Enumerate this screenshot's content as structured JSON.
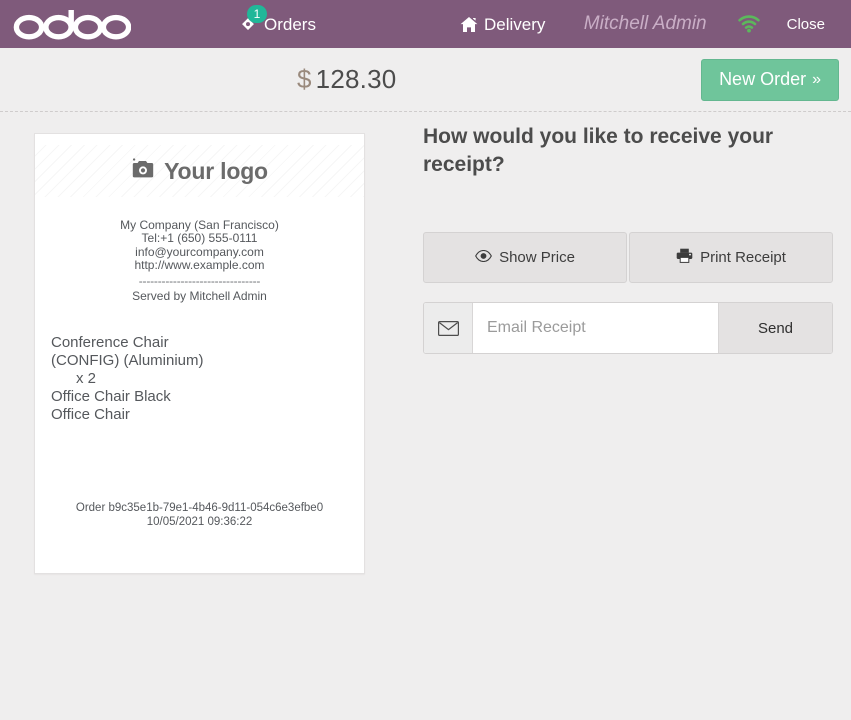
{
  "topbar": {
    "brand": "odoo",
    "orders": {
      "label": "Orders",
      "badge": "1",
      "icon": "tag-icon"
    },
    "delivery": {
      "label": "Delivery",
      "icon": "home-icon"
    },
    "username": "Mitchell Admin",
    "wifi_icon": "wifi-icon",
    "close_label": "Close",
    "bar_color": "#7f5a7b",
    "badge_color": "#21b799",
    "wifi_color": "#5cb85c"
  },
  "subheader": {
    "currency": "$",
    "total": "128.30",
    "new_order_label": "New Order",
    "new_order_chevron": "»",
    "new_order_color": "#6fc59b"
  },
  "receipt": {
    "logo_placeholder": "Your logo",
    "logo_icon": "camera-icon",
    "company": [
      "My Company (San Francisco)",
      "Tel:+1 (650) 555-0111",
      "info@yourcompany.com",
      "http://www.example.com"
    ],
    "divider": "--------------------------------",
    "served_by": "Served by Mitchell Admin",
    "orderlines": [
      {
        "text": "Conference Chair",
        "type": "product"
      },
      {
        "text": "(CONFIG) (Aluminium)",
        "type": "product"
      },
      {
        "text": "x 2",
        "type": "qty"
      },
      {
        "text": "Office Chair Black",
        "type": "product"
      },
      {
        "text": "Office Chair",
        "type": "product"
      }
    ],
    "order_ref": "Order b9c35e1b-79e1-4b46-9d11-054c6e3efbe0",
    "order_datetime": "10/05/2021 09:36:22"
  },
  "panel": {
    "title": "How would you like to receive your receipt?",
    "show_price": {
      "label": "Show Price",
      "icon": "eye-icon"
    },
    "print_receipt": {
      "label": "Print Receipt",
      "icon": "printer-icon"
    },
    "email": {
      "icon": "envelope-icon",
      "value": "",
      "placeholder": "Email Receipt",
      "send_label": "Send"
    }
  }
}
